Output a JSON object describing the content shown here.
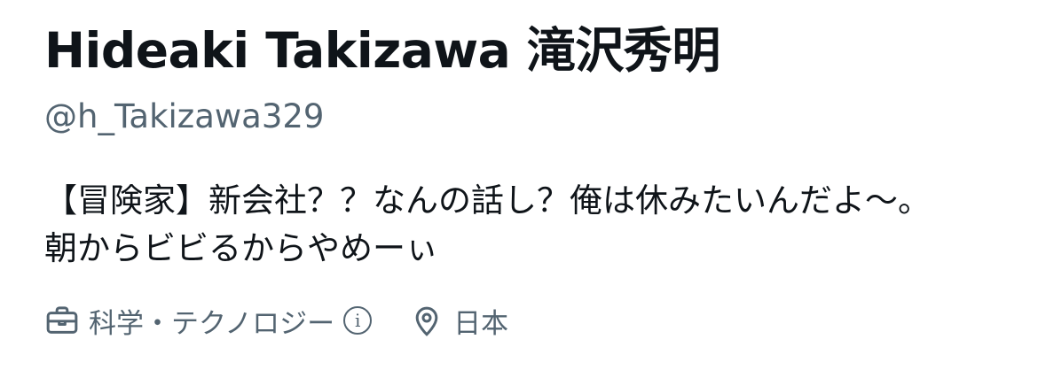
{
  "profile": {
    "display_name": "Hideaki Takizawa 滝沢秀明",
    "handle": "@h_Takizawa329",
    "bio": {
      "line1": "【冒険家】新会社？？なんの話し？俺は休みたいんだよ〜。",
      "line2": "朝からビビるからやめーぃ"
    },
    "meta": {
      "category": "科学・テクノロジー",
      "category_info_icon": "ⓘ",
      "location": "日本"
    },
    "icons": {
      "category": "briefcase-icon",
      "info": "info-icon",
      "location": "location-pin-icon"
    },
    "colors": {
      "primary_text": "#0f1419",
      "secondary_text": "#536471",
      "background": "#ffffff"
    }
  }
}
